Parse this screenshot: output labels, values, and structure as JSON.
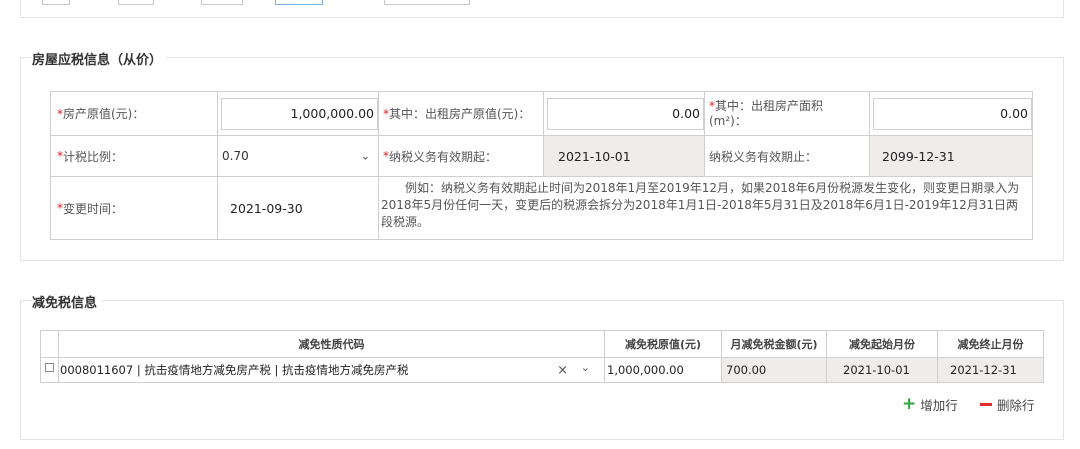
{
  "section_house": {
    "title": "房屋应税信息（从价）",
    "row1": {
      "original_value_label": "房产原值(元)：",
      "original_value": "1,000,000.00",
      "rented_value_label": "其中：出租房产原值(元)：",
      "rented_value": "0.00",
      "rented_area_label": "其中：出租房产面积(m²)：",
      "rented_area": "0.00"
    },
    "row2": {
      "tax_ratio_label": "计税比例：",
      "tax_ratio": "0.70",
      "obligation_start_label": "纳税义务有效期起：",
      "obligation_start": "2021-10-01",
      "obligation_end_label": "纳税义务有效期止：",
      "obligation_end": "2099-12-31"
    },
    "row3": {
      "change_time_label": "变更时间：",
      "change_time": "2021-09-30",
      "example_text": "例如：纳税义务有效期起止时间为2018年1月至2019年12月，如果2018年6月份税源发生变化，则变更日期录入为2018年5月份任何一天，变更后的税源会拆分为2018年1月1日-2018年5月31日及2018年6月1日-2019年12月31日两段税源。"
    },
    "required_mark": "*"
  },
  "section_relief": {
    "title": "减免税信息",
    "columns": {
      "code": "减免性质代码",
      "relief_value": "减免税原值(元)",
      "monthly_amount": "月减免税金额(元)",
      "start_month": "减免起始月份",
      "end_month": "减免终止月份"
    },
    "rows": [
      {
        "code": "0008011607 | 抗击疫情地方减免房产税 | 抗击疫情地方减免房产税",
        "relief_value": "1,000,000.00",
        "monthly_amount": "700.00",
        "start_month": "2021-10-01",
        "end_month": "2021-12-31"
      }
    ],
    "add_row_label": "增加行",
    "delete_row_label": "删除行"
  },
  "colors": {
    "required": "#e02020",
    "add": "#2ea73a",
    "delete": "#e52b2b",
    "readonly_bg": "#efecec"
  }
}
